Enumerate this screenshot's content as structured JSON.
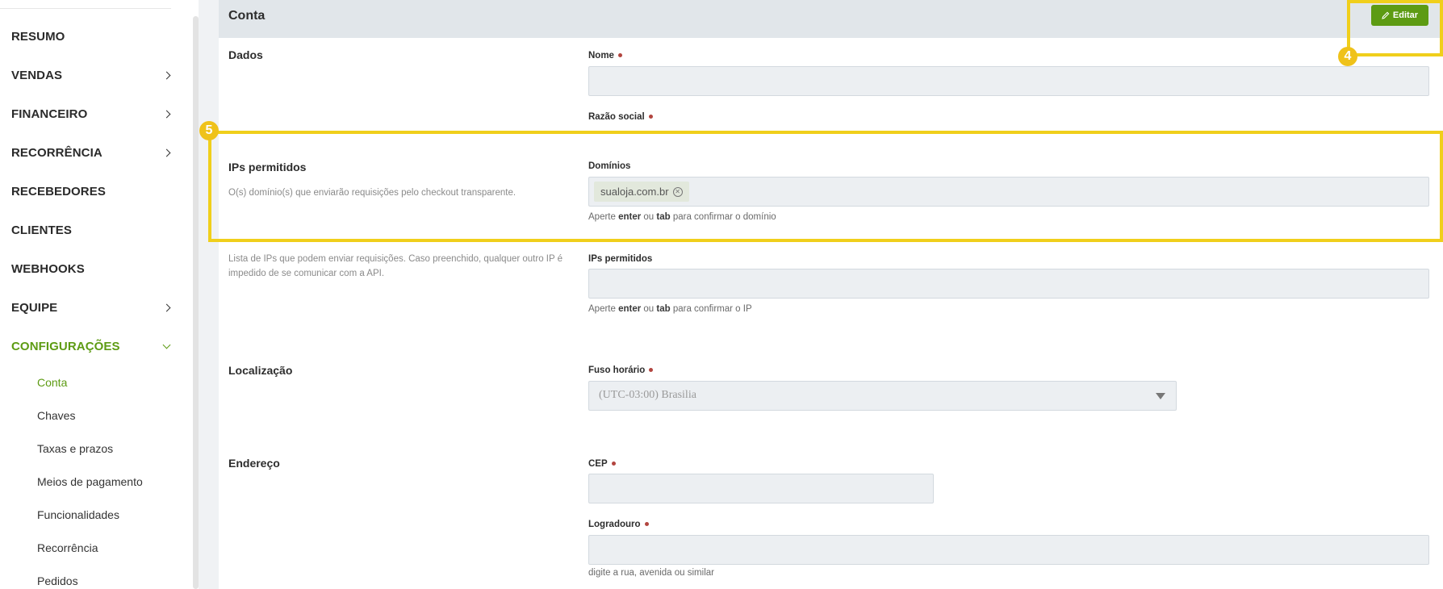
{
  "sidebar": {
    "items": [
      {
        "label": "RESUMO"
      },
      {
        "label": "VENDAS"
      },
      {
        "label": "FINANCEIRO"
      },
      {
        "label": "RECORRÊNCIA"
      },
      {
        "label": "RECEBEDORES"
      },
      {
        "label": "CLIENTES"
      },
      {
        "label": "WEBHOOKS"
      },
      {
        "label": "EQUIPE"
      },
      {
        "label": "CONFIGURAÇÕES"
      }
    ],
    "sub_items": [
      {
        "label": "Conta"
      },
      {
        "label": "Chaves"
      },
      {
        "label": "Taxas e prazos"
      },
      {
        "label": "Meios de pagamento"
      },
      {
        "label": "Funcionalidades"
      },
      {
        "label": "Recorrência"
      },
      {
        "label": "Pedidos"
      }
    ]
  },
  "panel": {
    "title": "Conta",
    "edit_label": "Editar"
  },
  "sections": {
    "dados": {
      "title": "Dados",
      "nome_label": "Nome",
      "razao_label": "Razão social"
    },
    "ips_permitidos": {
      "title": "IPs permitidos",
      "desc": "O(s) domínio(s) que enviarão requisições pelo checkout transparente.",
      "dominios_label": "Domínios",
      "dominio_chip": "sualoja.com.br",
      "dominio_hint_pre": "Aperte ",
      "dominio_hint_enter": "enter",
      "dominio_hint_mid": " ou ",
      "dominio_hint_tab": "tab",
      "dominio_hint_post": " para confirmar o domínio",
      "ips_desc": "Lista de IPs que podem enviar requisições. Caso preenchido, qualquer outro IP é impedido de se comunicar com a API.",
      "ips_label": "IPs permitidos",
      "ip_hint_post": " para confirmar o IP"
    },
    "localizacao": {
      "title": "Localização",
      "fuso_label": "Fuso horário",
      "fuso_value": "(UTC-03:00) Brasilia"
    },
    "endereco": {
      "title": "Endereço",
      "cep_label": "CEP",
      "logradouro_label": "Logradouro",
      "logradouro_hint": "digite a rua, avenida ou similar"
    }
  },
  "annotations": {
    "badge_4": "4",
    "badge_5": "5"
  },
  "colors": {
    "accent": "#5d9b13",
    "highlight": "#f0cf1b",
    "required": "#b2453f"
  }
}
